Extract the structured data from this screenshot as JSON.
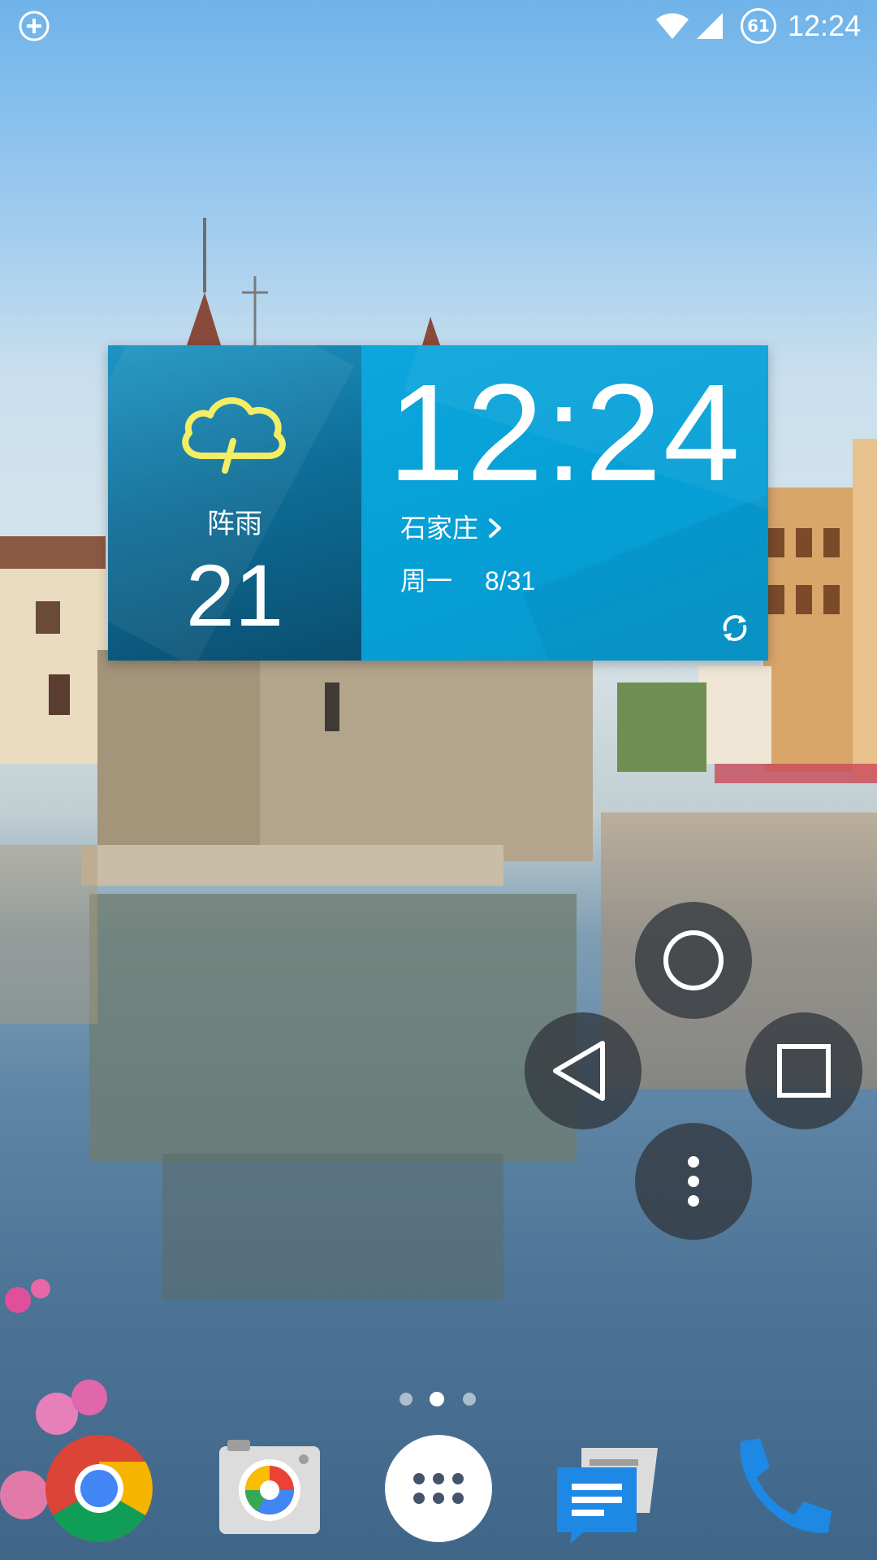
{
  "status_bar": {
    "left_icon": "add-circle-icon",
    "wifi_icon": "wifi-icon",
    "signal_icon": "cell-signal-icon",
    "battery_level": "61",
    "time": "12:24"
  },
  "weather_widget": {
    "weather_icon": "rain-cloud-icon",
    "condition": "阵雨",
    "temperature": "21",
    "clock_time": "12:24",
    "city": "石家庄",
    "weekday": "周一",
    "date": "8/31",
    "refresh_icon": "refresh-icon",
    "colors": {
      "left_panel": "#0e6e98",
      "right_panel": "#05a0d6"
    }
  },
  "nav_pie": {
    "home_icon": "circle-home-icon",
    "back_icon": "triangle-back-icon",
    "recents_icon": "square-recents-icon",
    "menu_icon": "vertical-dots-icon"
  },
  "page_indicator": {
    "count": 3,
    "active_index": 1
  },
  "dock": {
    "apps": [
      {
        "name": "Chrome",
        "icon": "chrome-icon"
      },
      {
        "name": "Camera",
        "icon": "camera-icon"
      },
      {
        "name": "App Drawer",
        "icon": "app-drawer-icon"
      },
      {
        "name": "Messages",
        "icon": "messages-icon"
      },
      {
        "name": "Phone",
        "icon": "phone-icon"
      }
    ]
  }
}
